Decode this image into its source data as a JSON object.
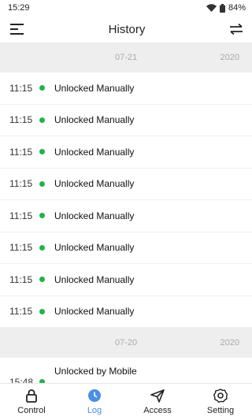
{
  "status_bar": {
    "time": "15:29",
    "battery": "84%"
  },
  "header": {
    "title": "History",
    "menu_icon": "menu-icon",
    "swap_icon": "swap-icon"
  },
  "sections": [
    {
      "date": "07-21",
      "year": "2020",
      "entries": [
        {
          "time": "11:15",
          "event": "Unlocked Manually"
        },
        {
          "time": "11:15",
          "event": "Unlocked Manually"
        },
        {
          "time": "11:15",
          "event": "Unlocked Manually"
        },
        {
          "time": "11:15",
          "event": "Unlocked Manually"
        },
        {
          "time": "11:15",
          "event": "Unlocked Manually"
        },
        {
          "time": "11:15",
          "event": "Unlocked Manually"
        },
        {
          "time": "11:15",
          "event": "Unlocked Manually"
        },
        {
          "time": "11:15",
          "event": "Unlocked Manually"
        }
      ]
    },
    {
      "date": "07-20",
      "year": "2020",
      "entries": [
        {
          "time": "15:48",
          "event": "Unlocked by Mobile"
        }
      ]
    }
  ],
  "colors": {
    "status_dot": "#22b14c",
    "active_tab": "#4a90e2"
  },
  "nav": [
    {
      "label": "Control",
      "icon": "lock-icon",
      "active": false
    },
    {
      "label": "Log",
      "icon": "clock-icon",
      "active": true
    },
    {
      "label": "Access",
      "icon": "send-icon",
      "active": false
    },
    {
      "label": "Setting",
      "icon": "gear-icon",
      "active": false
    }
  ]
}
